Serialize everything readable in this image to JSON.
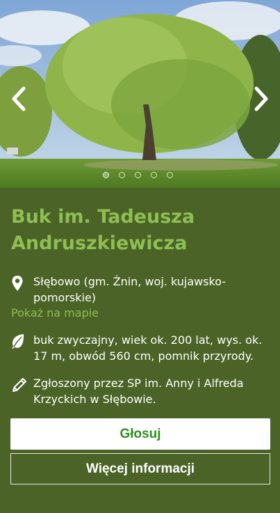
{
  "carousel": {
    "image_alt": "beech tree photo",
    "prev_icon": "chevron-left-icon",
    "next_icon": "chevron-right-icon",
    "dots_count": 5,
    "active_index": 0
  },
  "tree": {
    "name": "Buk im. Tadeusza Andruszkiewicza",
    "location": "Słębowo (gm. Żnin, woj. kujawsko-pomorskie)",
    "map_link": "Pokaż na mapie",
    "description": "buk zwyczajny, wiek ok. 200 lat, wys. ok. 17 m, obwód 560 cm, pomnik przyrody.",
    "submitted_by": "Zgłoszony przez SP im. Anny i Alfreda Krzyckich w Słębowie."
  },
  "icons": {
    "location": "map-pin-icon",
    "description": "leaf-icon",
    "submitted": "pencil-icon"
  },
  "buttons": {
    "vote": "Głosuj",
    "more_info": "Więcej informacji"
  },
  "colors": {
    "background": "#4b6327",
    "accent": "#8fbe52",
    "vote_text": "#2f8f1a"
  }
}
